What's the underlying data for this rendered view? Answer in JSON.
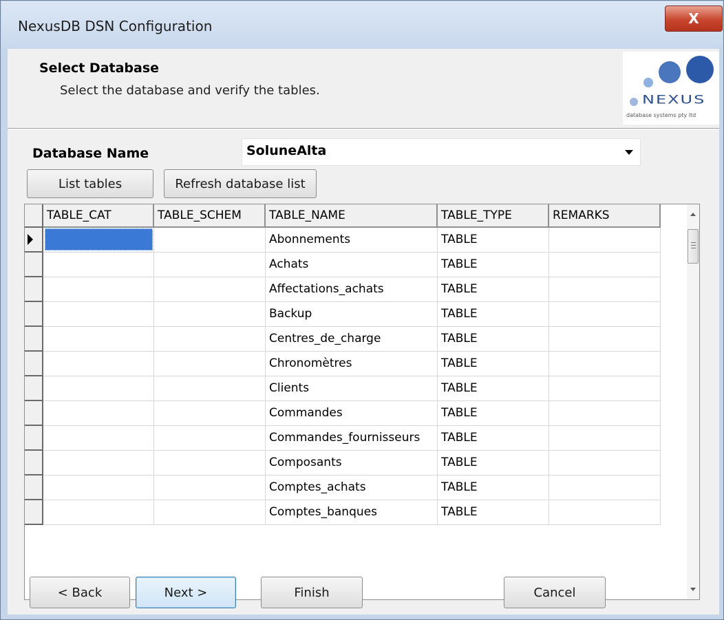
{
  "window": {
    "title": "NexusDB DSN Configuration",
    "close_glyph": "X"
  },
  "header": {
    "title": "Select Database",
    "subtitle": "Select the database and verify the tables.",
    "logo": {
      "brand": "NEXUS",
      "tagline": "database systems pty ltd"
    }
  },
  "database": {
    "label": "Database Name",
    "selected": "SoluneAlta"
  },
  "actions": {
    "list_tables": "List tables",
    "refresh": "Refresh database list"
  },
  "grid": {
    "columns": [
      "TABLE_CAT",
      "TABLE_SCHEM",
      "TABLE_NAME",
      "TABLE_TYPE",
      "REMARKS"
    ],
    "rows": [
      [
        "",
        "",
        "Abonnements",
        "TABLE",
        ""
      ],
      [
        "",
        "",
        "Achats",
        "TABLE",
        ""
      ],
      [
        "",
        "",
        "Affectations_achats",
        "TABLE",
        ""
      ],
      [
        "",
        "",
        "Backup",
        "TABLE",
        ""
      ],
      [
        "",
        "",
        "Centres_de_charge",
        "TABLE",
        ""
      ],
      [
        "",
        "",
        "Chronomètres",
        "TABLE",
        ""
      ],
      [
        "",
        "",
        "Clients",
        "TABLE",
        ""
      ],
      [
        "",
        "",
        "Commandes",
        "TABLE",
        ""
      ],
      [
        "",
        "",
        "Commandes_fournisseurs",
        "TABLE",
        ""
      ],
      [
        "",
        "",
        "Composants",
        "TABLE",
        ""
      ],
      [
        "",
        "",
        "Comptes_achats",
        "TABLE",
        ""
      ],
      [
        "",
        "",
        "Comptes_banques",
        "TABLE",
        ""
      ]
    ]
  },
  "footer": {
    "back": "< Back",
    "next": "Next >",
    "finish": "Finish",
    "cancel": "Cancel"
  },
  "colors": {
    "accent": "#3b79d6",
    "logo_blue": "#2c4f8e"
  }
}
